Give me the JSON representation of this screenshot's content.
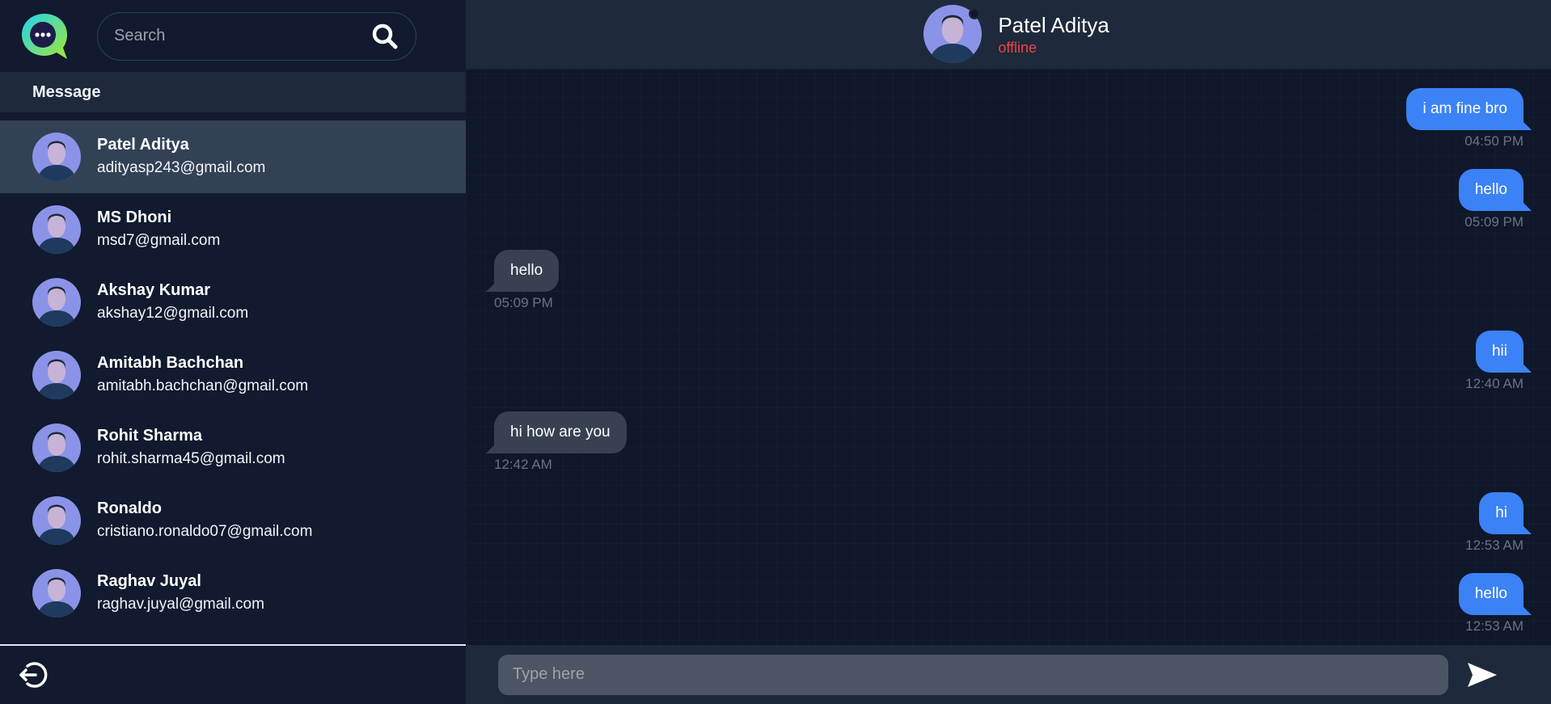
{
  "sidebar": {
    "search": {
      "placeholder": "Search"
    },
    "section_title": "Message",
    "contacts": [
      {
        "name": "Patel Aditya",
        "email": "adityasp243@gmail.com",
        "active": true
      },
      {
        "name": "MS Dhoni",
        "email": "msd7@gmail.com"
      },
      {
        "name": "Akshay Kumar",
        "email": "akshay12@gmail.com"
      },
      {
        "name": "Amitabh Bachchan",
        "email": "amitabh.bachchan@gmail.com"
      },
      {
        "name": "Rohit Sharma",
        "email": "rohit.sharma45@gmail.com"
      },
      {
        "name": "Ronaldo",
        "email": "cristiano.ronaldo07@gmail.com"
      },
      {
        "name": "Raghav Juyal",
        "email": "raghav.juyal@gmail.com"
      }
    ]
  },
  "chat": {
    "header": {
      "name": "Patel Aditya",
      "status": "offline"
    },
    "messages": [
      {
        "text": "i am fine bro",
        "time": "04:50 PM",
        "direction": "out"
      },
      {
        "text": "hello",
        "time": "05:09 PM",
        "direction": "out"
      },
      {
        "text": "hello",
        "time": "05:09 PM",
        "direction": "in"
      },
      {
        "text": "hii",
        "time": "12:40 AM",
        "direction": "out"
      },
      {
        "text": "hi how are you",
        "time": "12:42 AM",
        "direction": "in"
      },
      {
        "text": "hi",
        "time": "12:53 AM",
        "direction": "out"
      },
      {
        "text": "hello",
        "time": "12:53 AM",
        "direction": "out"
      }
    ],
    "composer": {
      "placeholder": "Type here"
    }
  },
  "colors": {
    "accent": "#3b82f6",
    "incoming_bubble": "#374151",
    "offline_status": "#ef4444",
    "logo_cyan": "#22d3ee",
    "logo_lime": "#a3e635"
  },
  "icons": {
    "logo": "chat-bubble-logo",
    "search": "search-icon",
    "logout": "logout-icon",
    "send": "send-icon"
  }
}
